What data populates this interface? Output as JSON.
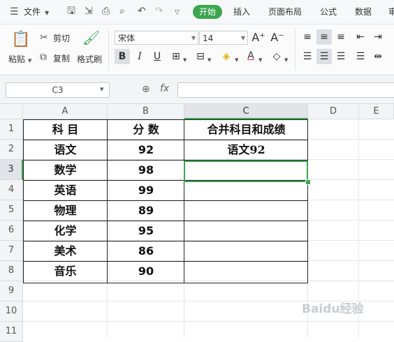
{
  "menu": {
    "file_label": "文件",
    "tabs": [
      "开始",
      "插入",
      "页面布局",
      "公式",
      "数据",
      "审"
    ]
  },
  "ribbon": {
    "paste": "粘贴",
    "cut": "剪切",
    "copy": "复制",
    "format_painter": "格式刷",
    "font_name": "宋体",
    "font_size": "14",
    "bold": "B",
    "italic": "I",
    "underline": "U",
    "grow_font": "A⁺",
    "shrink_font": "A⁻"
  },
  "formula_bar": {
    "name_box": "C3",
    "fx": "fx",
    "value": ""
  },
  "grid": {
    "columns": [
      "A",
      "B",
      "C",
      "D",
      "E"
    ],
    "rows": [
      "1",
      "2",
      "3",
      "4",
      "5",
      "6",
      "7",
      "8",
      "9",
      "10",
      "11"
    ],
    "cells": [
      [
        "科  目",
        "分  数",
        "合并科目和成绩"
      ],
      [
        "语文",
        "92",
        "语文92"
      ],
      [
        "数学",
        "98",
        ""
      ],
      [
        "英语",
        "99",
        ""
      ],
      [
        "物理",
        "89",
        ""
      ],
      [
        "化学",
        "95",
        ""
      ],
      [
        "美术",
        "86",
        ""
      ],
      [
        "音乐",
        "90",
        ""
      ]
    ],
    "selected_cell": "C3"
  },
  "watermark": "Baidu经验",
  "colors": {
    "accent": "#3aa64f"
  }
}
